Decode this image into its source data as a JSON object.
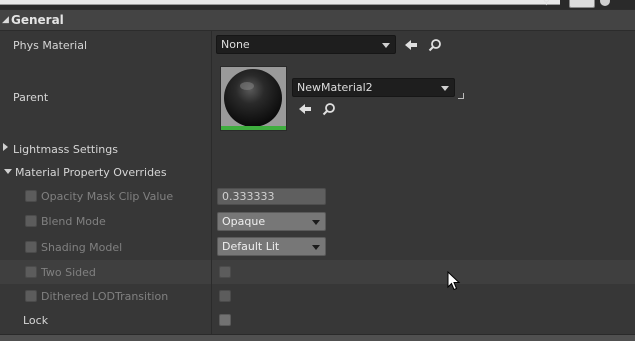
{
  "topbar": {
    "search_icon": "search-icon",
    "options_icon": "options-icon"
  },
  "section": {
    "title": "General",
    "expanded": true
  },
  "phys_material": {
    "label": "Phys Material",
    "value": "None",
    "use_icon": "arrow-left-icon",
    "browse_icon": "magnifier-icon"
  },
  "parent": {
    "label": "Parent",
    "value": "NewMaterial2",
    "use_icon": "arrow-left-icon",
    "browse_icon": "magnifier-icon",
    "thumbnail_icon": "material-sphere-icon"
  },
  "lightmass": {
    "label": "Lightmass Settings",
    "expanded": false
  },
  "overrides": {
    "label": "Material Property Overrides",
    "expanded": true,
    "items": [
      {
        "label": "Opacity Mask Clip Value",
        "value": "0.333333"
      },
      {
        "label": "Blend Mode",
        "value": "Opaque"
      },
      {
        "label": "Shading Model",
        "value": "Default Lit"
      },
      {
        "label": "Two Sided"
      },
      {
        "label": "Dithered LODTransition"
      }
    ]
  },
  "lock": {
    "label": "Lock"
  },
  "colors": {
    "background": "#373737",
    "header": "#444444",
    "hover_row": "#3f3f3f",
    "accent_green": "#3fae3f"
  }
}
